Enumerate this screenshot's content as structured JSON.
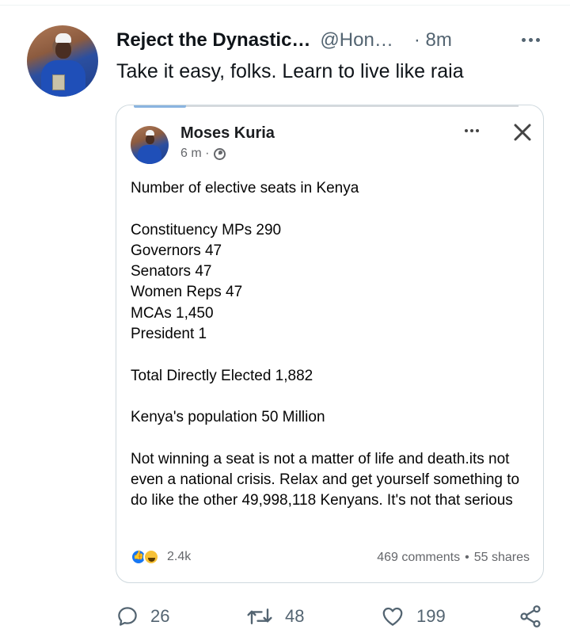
{
  "tweet": {
    "display_name": "Reject the Dynastic…",
    "handle": "@Hon…",
    "timestamp": "· 8m",
    "text": "Take it easy, folks. Learn to live like raia"
  },
  "embedded_post": {
    "author": "Moses Kuria",
    "time": "6 m ·",
    "lines": [
      "Number of elective seats in Kenya",
      "",
      "Constituency MPs 290",
      "Governors 47",
      "Senators 47",
      "Women Reps 47",
      "MCAs 1,450",
      "President 1",
      "",
      "Total Directly Elected 1,882",
      "",
      "Kenya's population 50 Million",
      "",
      "Not winning a seat is not a matter of life and death.its not even a national crisis.  Relax and get yourself something to do like the other 49,998,118 Kenyans. It's not that serious"
    ],
    "reactions_count": "2.4k",
    "comments": "469 comments",
    "separator": "•",
    "shares": "55 shares"
  },
  "actions": {
    "replies": "26",
    "retweets": "48",
    "likes": "199"
  },
  "icons": {
    "reply": "reply-icon",
    "retweet": "retweet-icon",
    "like": "heart-icon",
    "share": "share-icon",
    "close": "close-icon",
    "more": "more-icon",
    "privacy": "globe-icon"
  },
  "colors": {
    "text": "#0f1419",
    "secondary": "#536471",
    "fb_secondary": "#65676b",
    "fb_blue": "#1877f2",
    "border": "#cfd9de"
  }
}
